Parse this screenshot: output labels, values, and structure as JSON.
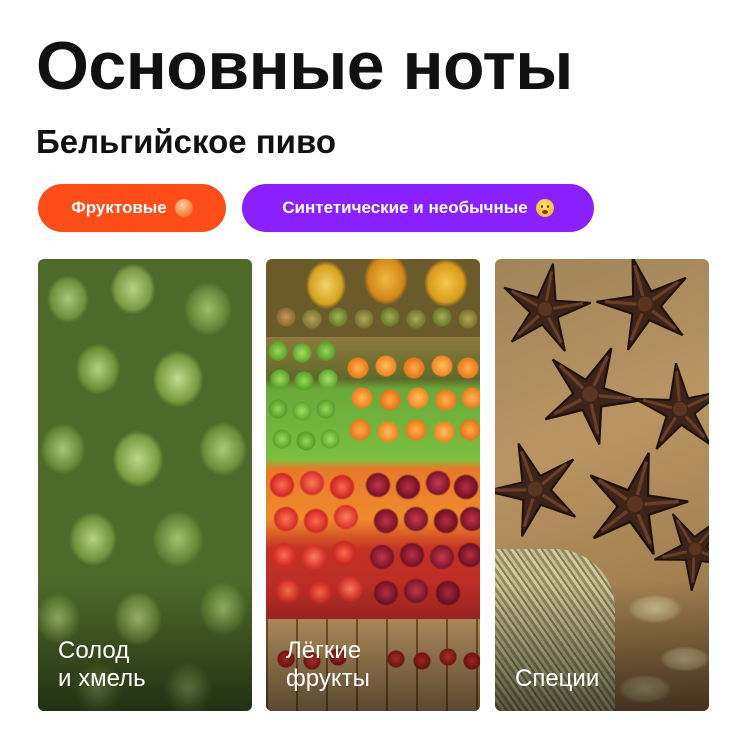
{
  "title": "Основные ноты",
  "subtitle": "Бельгийское пиво",
  "tags": [
    {
      "label": "Фруктовые",
      "color": "#ff4d1a",
      "icon": "peach-emoji-icon"
    },
    {
      "label": "Синтетические и необычные",
      "color": "#8a1fff",
      "icon": "surprised-face-emoji-icon"
    }
  ],
  "cards": [
    {
      "line1": "Солод",
      "line2": "и хмель",
      "image": "hops-photo"
    },
    {
      "line1": "Лёгкие",
      "line2": "фрукты",
      "image": "fruit-market-photo"
    },
    {
      "line1": "Специи",
      "line2": "",
      "image": "star-anise-spices-photo"
    }
  ]
}
